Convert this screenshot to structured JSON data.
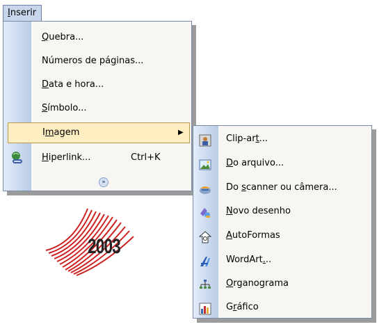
{
  "menubar": {
    "item_label_underlined": "I",
    "item_label_rest": "nserir"
  },
  "main_menu": {
    "items": [
      {
        "pre": "",
        "u": "Q",
        "post": "uebra..."
      },
      {
        "pre": "Números de pá",
        "u": "g",
        "post": "inas..."
      },
      {
        "pre": "",
        "u": "D",
        "post": "ata e hora..."
      },
      {
        "pre": "",
        "u": "S",
        "post": "ímbolo..."
      },
      {
        "pre": "I",
        "u": "m",
        "post": "agem"
      },
      {
        "pre": "",
        "u": "H",
        "post": "iperlink...",
        "shortcut": "Ctrl+K"
      }
    ],
    "expand_icon": "double-chevron-down-icon"
  },
  "submenu": {
    "items": [
      {
        "pre": "Clip-ar",
        "u": "t",
        "post": "...",
        "icon": "clipart-icon"
      },
      {
        "pre": "",
        "u": "D",
        "post": "o arquivo...",
        "icon": "picture-file-icon"
      },
      {
        "pre": "Do ",
        "u": "s",
        "post": "canner ou câmera...",
        "icon": "scanner-camera-icon"
      },
      {
        "pre": "",
        "u": "N",
        "post": "ovo desenho",
        "icon": "new-drawing-icon"
      },
      {
        "pre": "",
        "u": "A",
        "post": "utoFormas",
        "icon": "autoshapes-icon"
      },
      {
        "pre": "WordArt",
        "u": ".",
        "post": "..",
        "icon": "wordart-icon"
      },
      {
        "pre": "",
        "u": "O",
        "post": "rganograma",
        "icon": "org-chart-icon"
      },
      {
        "pre": "G",
        "u": "r",
        "post": "áfico",
        "icon": "chart-icon"
      }
    ]
  },
  "logo": {
    "year": "2003"
  },
  "colors": {
    "highlight": "#ffeec2",
    "gutter": "#b9cbe6",
    "menu_bg": "#f7f6f3",
    "logo_red": "#cc2222"
  }
}
